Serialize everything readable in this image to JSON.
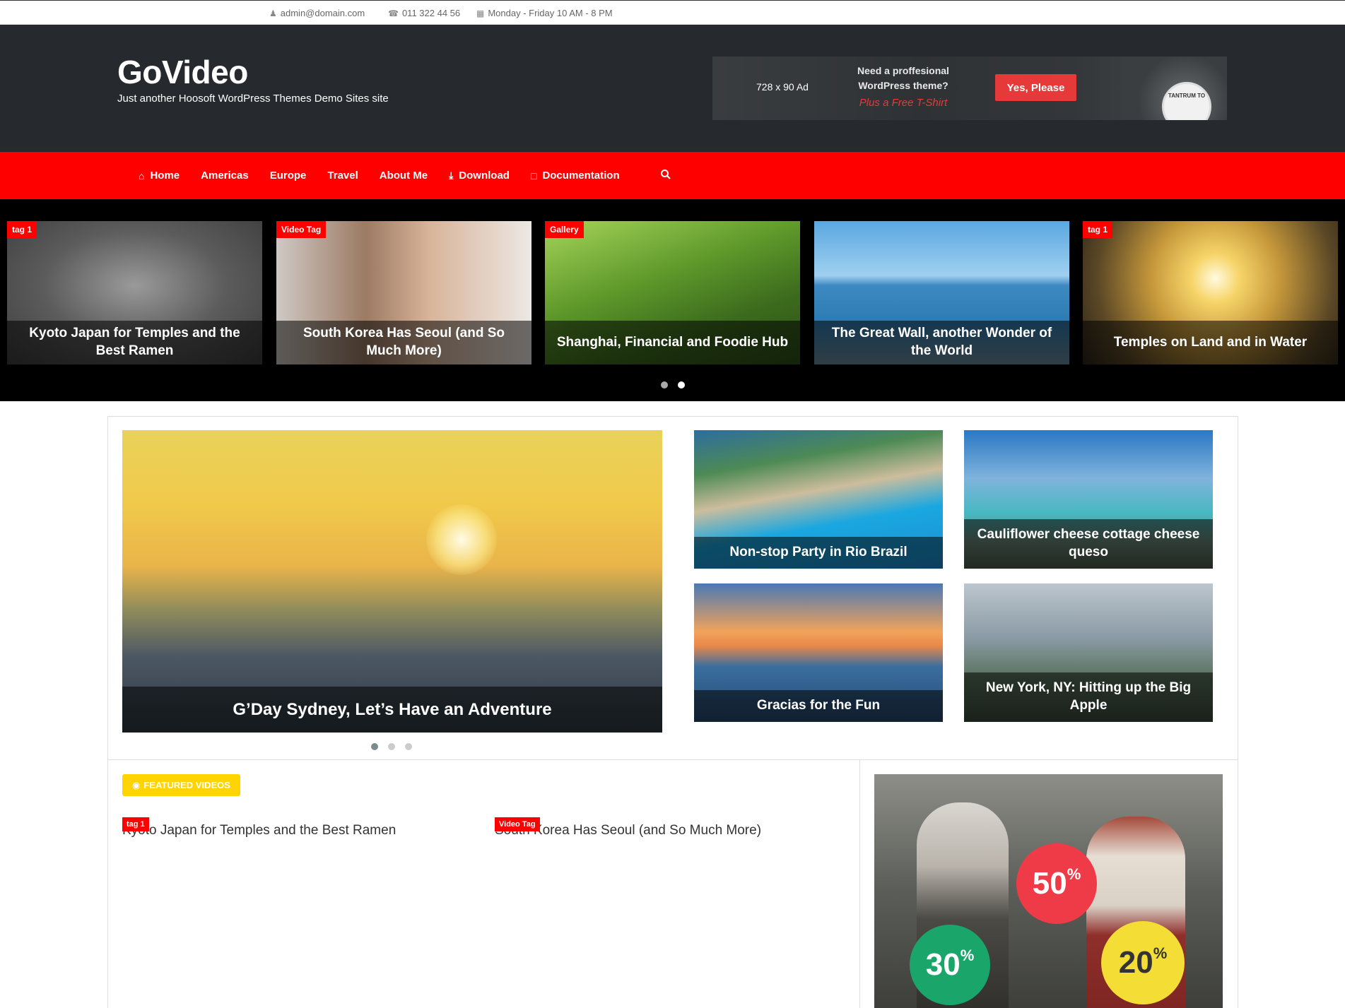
{
  "topbar": {
    "email": "admin@domain.com",
    "phone": "011 322 44 56",
    "hours": "Monday - Friday 10 AM - 8 PM"
  },
  "header": {
    "site_title": "GoVideo",
    "site_description": "Just another Hoosoft WordPress Themes Demo Sites site",
    "ad": {
      "size_label": "728 x 90 Ad",
      "question": "Need a proffesional WordPress theme?",
      "offer": "Plus a Free T-Shirt",
      "button": "Yes, Please",
      "shirt_text": "TANTRUM TO"
    }
  },
  "nav": {
    "items": [
      "Home",
      "Americas",
      "Europe",
      "Travel",
      "About Me",
      "Download",
      "Documentation"
    ]
  },
  "slider": {
    "cards": [
      {
        "tag": "tag 1",
        "title": "Kyoto Japan for Temples and the Best Ramen"
      },
      {
        "tag": "Video Tag",
        "title": "South Korea Has Seoul (and So Much More)"
      },
      {
        "tag": "Gallery",
        "title": "Shanghai, Financial and Foodie Hub"
      },
      {
        "tag": "",
        "title": "The Great Wall, another Wonder of the World"
      },
      {
        "tag": "tag 1",
        "title": "Temples on Land and in Water"
      }
    ],
    "pages": 2,
    "active_page": 2
  },
  "hero": {
    "title": "G’Day Sydney, Let’s Have an Adventure",
    "pages": 3,
    "active_page": 1
  },
  "grid": {
    "cards": [
      {
        "title": "Non-stop Party in Rio Brazil"
      },
      {
        "title": "Cauliflower cheese cottage cheese queso"
      },
      {
        "title": "Gracias for the Fun"
      },
      {
        "title": "New York, NY: Hitting up the Big Apple"
      }
    ]
  },
  "featured": {
    "badge": "FEATURED VIDEOS",
    "cards": [
      {
        "tag": "tag 1",
        "title": "Kyoto Japan for Temples and the Best Ramen"
      },
      {
        "tag": "Video Tag",
        "title": "South Korea Has Seoul (and So Much More)"
      }
    ]
  },
  "promo": {
    "discounts": [
      "50",
      "30",
      "20"
    ],
    "percent_sign": "%"
  },
  "colors": {
    "accent": "#ff0000",
    "header_bg": "#262a2e",
    "featured_badge": "#ffd400"
  }
}
